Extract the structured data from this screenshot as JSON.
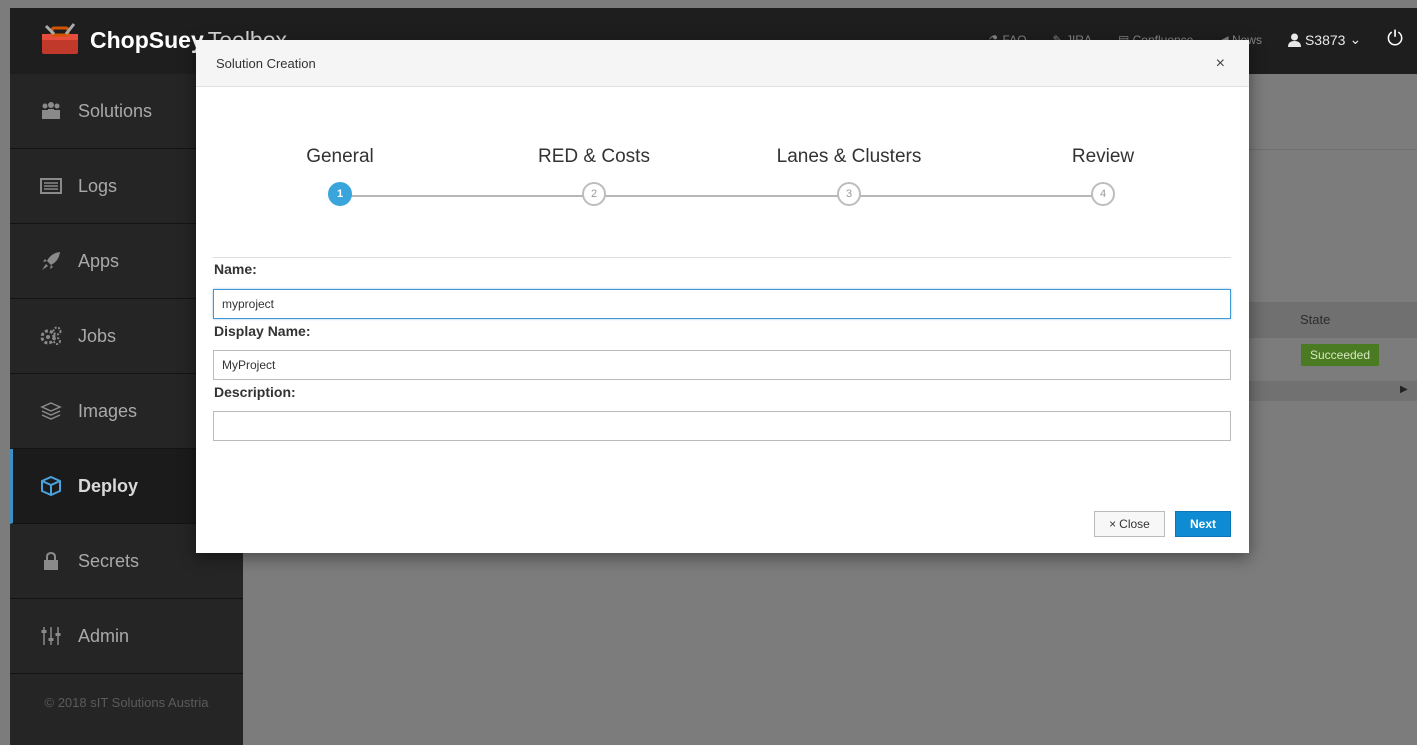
{
  "navbar": {
    "brand_name": "ChopSuey",
    "brand_sub": "Toolbox",
    "items": [
      {
        "label": "FAQ",
        "icon": "flask-icon"
      },
      {
        "label": "JIRA",
        "icon": "ticket-icon"
      },
      {
        "label": "Confluence",
        "icon": "book-icon"
      },
      {
        "label": "News",
        "icon": "megaphone-icon"
      }
    ],
    "user": "S3873",
    "user_caret": "⌄"
  },
  "sidebar": {
    "items": [
      {
        "label": "Solutions",
        "icon": "users-icon"
      },
      {
        "label": "Logs",
        "icon": "list-icon"
      },
      {
        "label": "Apps",
        "icon": "rocket-icon"
      },
      {
        "label": "Jobs",
        "icon": "gears-icon"
      },
      {
        "label": "Images",
        "icon": "layers-icon"
      },
      {
        "label": "Deploy",
        "icon": "cube-icon"
      },
      {
        "label": "Secrets",
        "icon": "lock-icon"
      },
      {
        "label": "Admin",
        "icon": "sliders-icon"
      }
    ],
    "active": "Deploy",
    "copyright": "© 2018 sIT Solutions Austria"
  },
  "background": {
    "state_header": "State",
    "state_badge": "Succeeded"
  },
  "modal": {
    "title": "Solution Creation",
    "close_glyph": "×",
    "steps": [
      {
        "label": "General",
        "number": "1"
      },
      {
        "label": "RED & Costs",
        "number": "2"
      },
      {
        "label": "Lanes & Clusters",
        "number": "3"
      },
      {
        "label": "Review",
        "number": "4"
      }
    ],
    "active_step": 1,
    "form": {
      "name_label": "Name:",
      "name_value": "myproject",
      "display_name_label": "Display Name:",
      "display_name_value": "MyProject",
      "description_label": "Description:",
      "description_value": ""
    },
    "buttons": {
      "close_icon": "×",
      "close_label": "Close",
      "next_label": "Next"
    }
  },
  "colors": {
    "navbar_bg": "#1e1e1e",
    "sidebar_bg": "#252526",
    "accent": "#39a5dc",
    "primary_button": "#0e8bd3",
    "success": "#4a7a22"
  }
}
